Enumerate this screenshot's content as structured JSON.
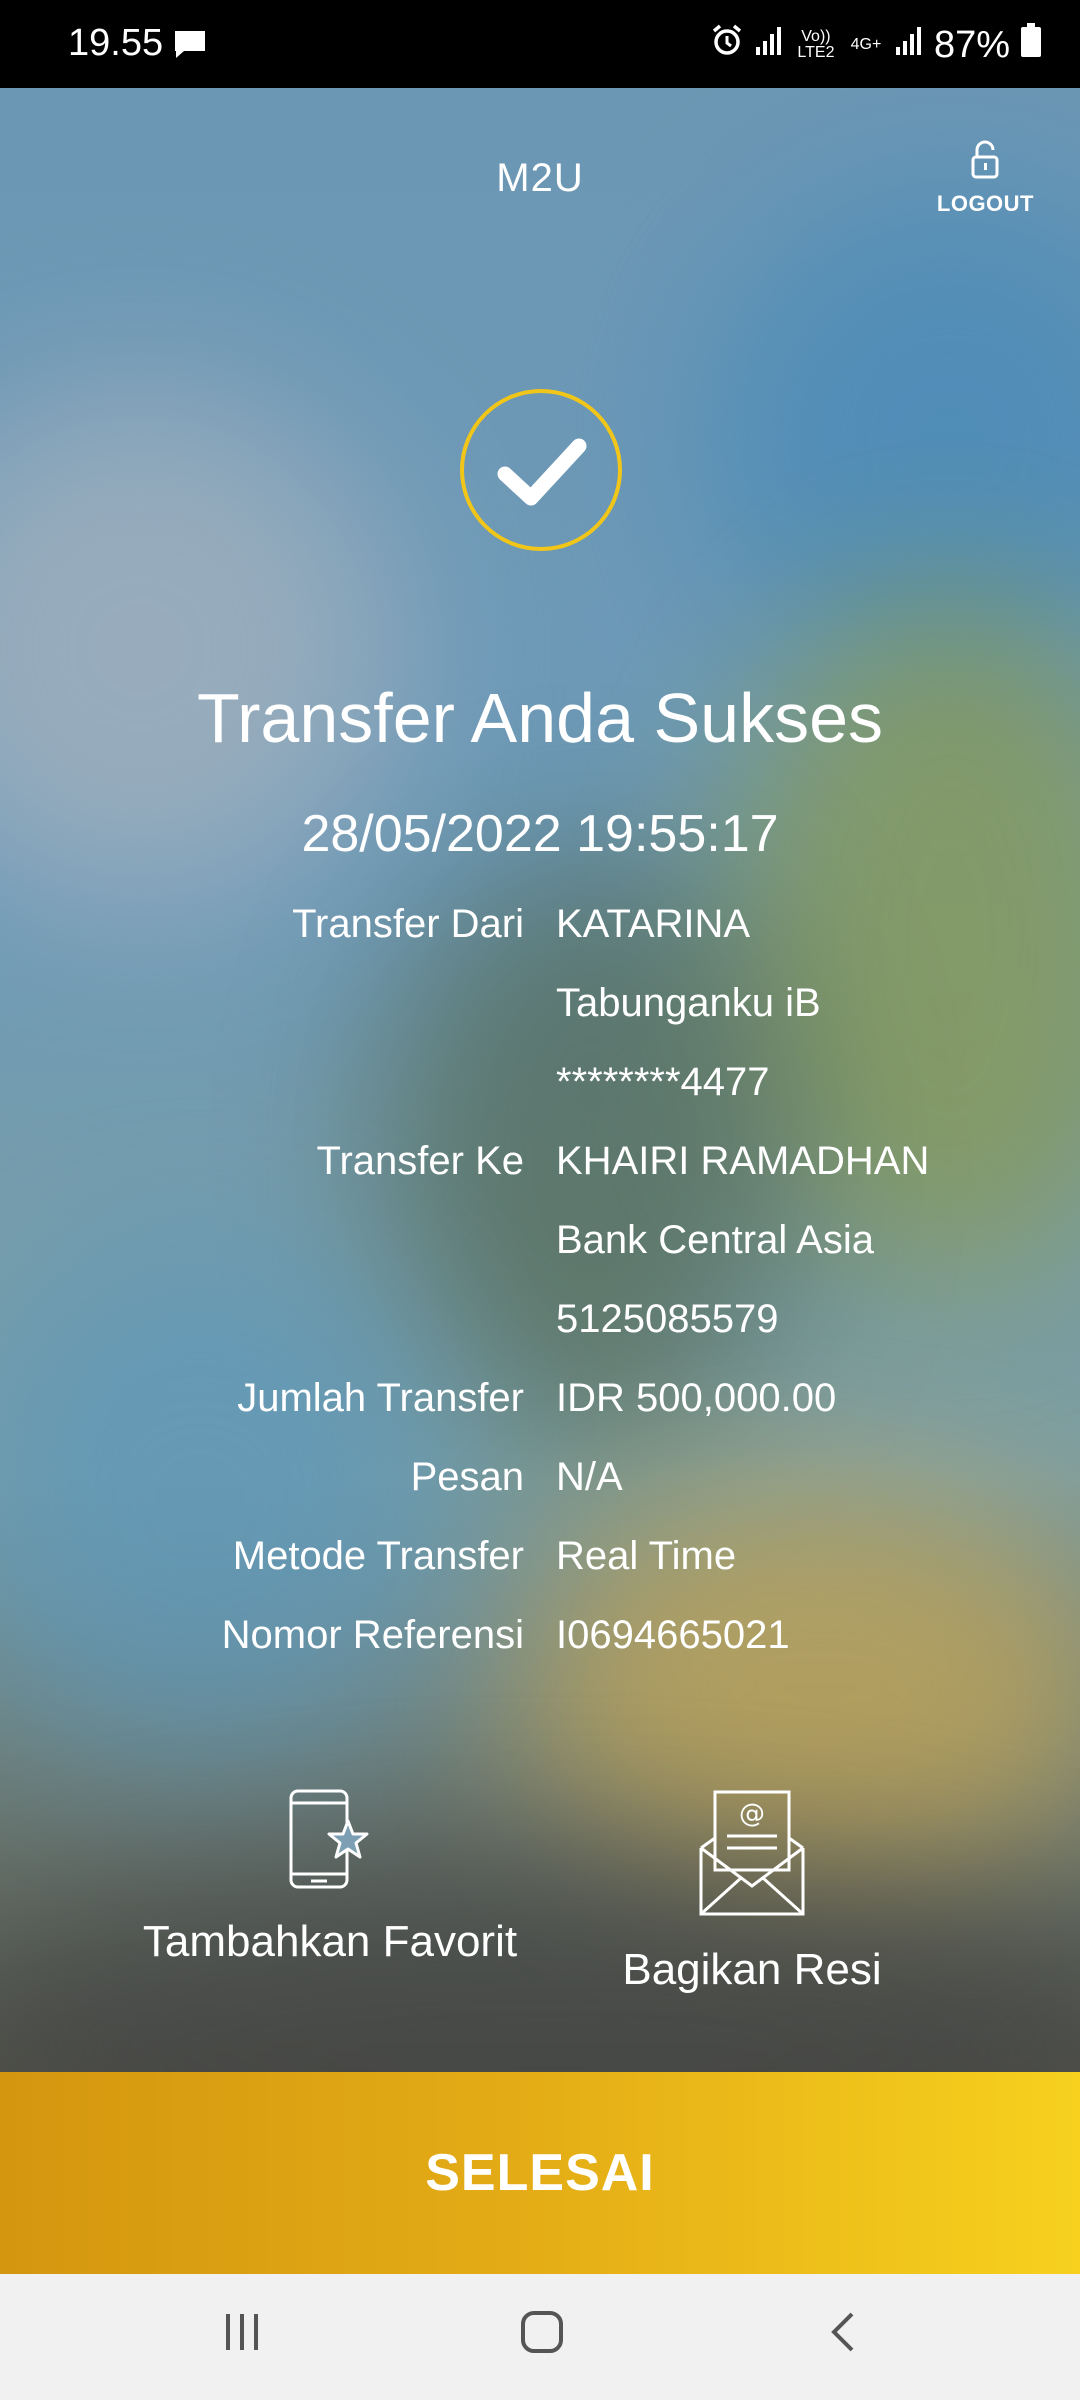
{
  "status_bar": {
    "time": "19.55",
    "network_1": "Vo)) LTE2",
    "network_2": "4G+",
    "battery": "87%"
  },
  "header": {
    "title": "M2U",
    "logout_label": "LOGOUT"
  },
  "result": {
    "title": "Transfer Anda Sukses",
    "datetime": "28/05/2022 19:55:17"
  },
  "details": {
    "from_label": "Transfer Dari",
    "from_name": "KATARINA",
    "from_product": "Tabunganku iB",
    "from_account": "********4477",
    "to_label": "Transfer Ke",
    "to_name": "KHAIRI RAMADHAN",
    "to_bank": "Bank Central Asia",
    "to_account": "5125085579",
    "amount_label": "Jumlah Transfer",
    "amount": "IDR 500,000.00",
    "message_label": "Pesan",
    "message": "N/A",
    "method_label": "Metode Transfer",
    "method": "Real Time",
    "reference_label": "Nomor Referensi",
    "reference": "I06946650​21"
  },
  "actions": {
    "favorite_label": "Tambahkan Favorit",
    "share_label": "Bagikan Resi"
  },
  "done_label": "SELESAI",
  "colors": {
    "accent_yellow": "#f2c618",
    "button_gradient_start": "#d4960f",
    "button_gradient_end": "#f7d11e"
  }
}
